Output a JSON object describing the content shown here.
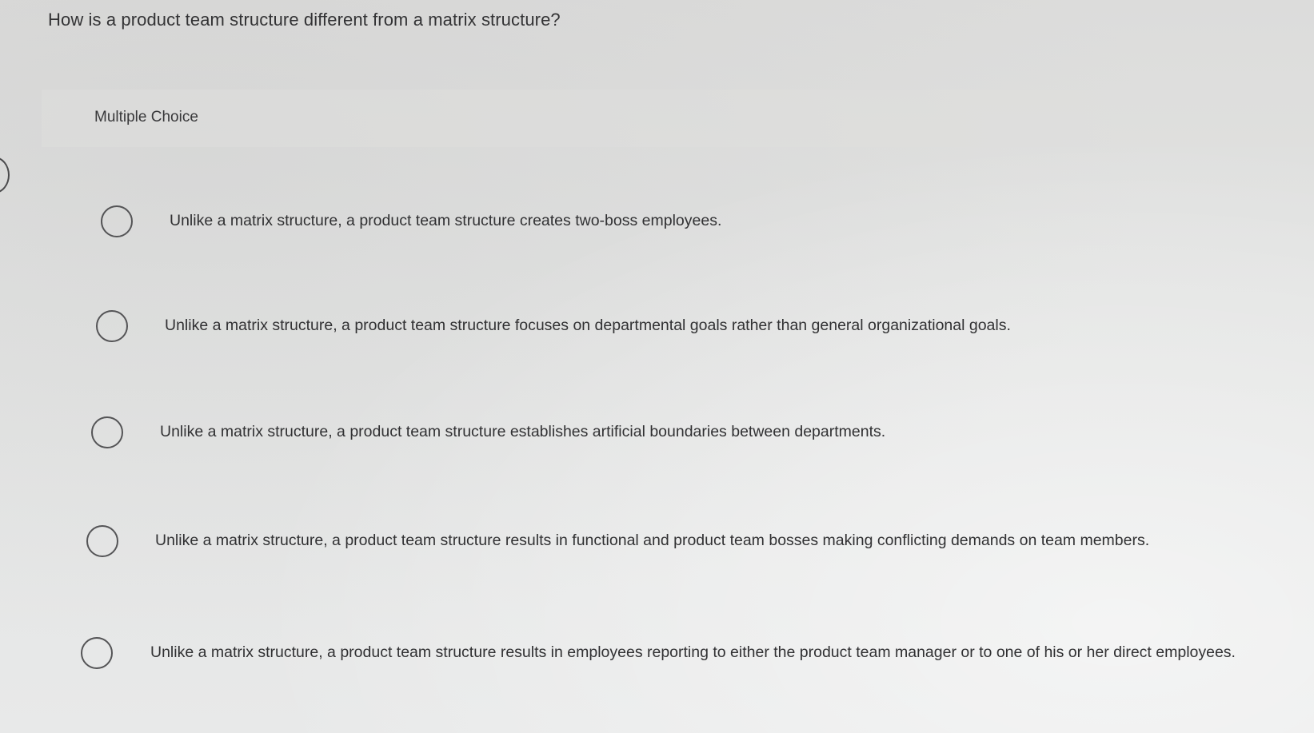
{
  "question": {
    "text": "How is a product team structure different from a matrix structure?"
  },
  "question_type": {
    "label": "Multiple Choice"
  },
  "options": [
    {
      "label": "Unlike a matrix structure, a product team structure creates two-boss employees.",
      "selected": false
    },
    {
      "label": "Unlike a matrix structure, a product team structure focuses on departmental goals rather than general organizational goals.",
      "selected": false
    },
    {
      "label": "Unlike a matrix structure, a product team structure establishes artificial boundaries between departments.",
      "selected": false
    },
    {
      "label": "Unlike a matrix structure, a product team structure results in functional and product team bosses making conflicting demands on team members.",
      "selected": false
    },
    {
      "label": "Unlike a matrix structure, a product team structure results in employees reporting to either the product team manager or to one of his or her direct employees.",
      "selected": false
    }
  ],
  "colors": {
    "background": "#e2e3e2",
    "text": "#313133",
    "radio_border": "#545456"
  }
}
